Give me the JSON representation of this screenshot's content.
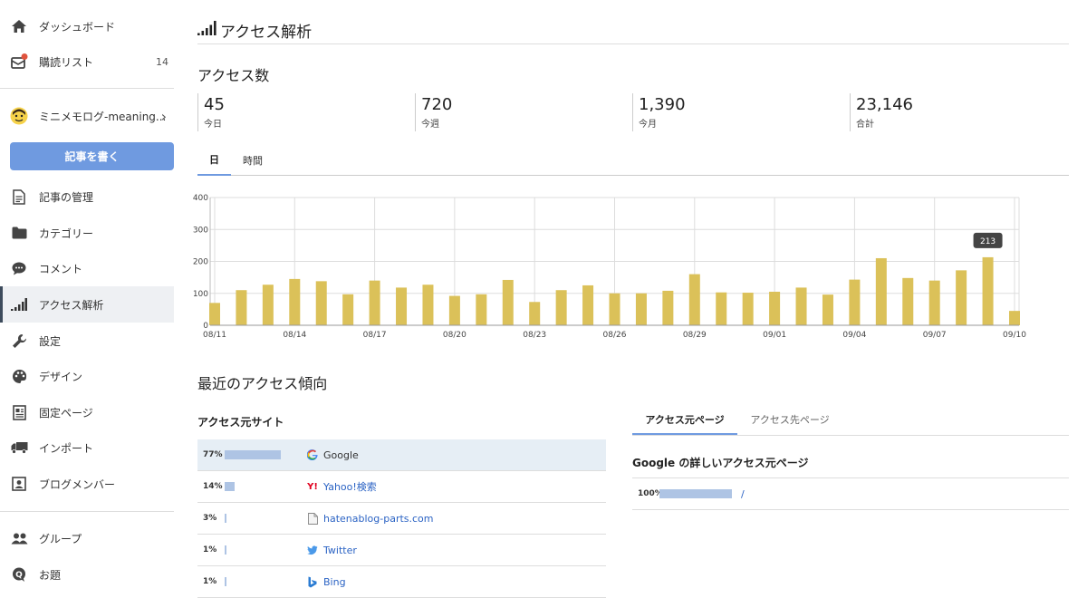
{
  "sidebar": {
    "dashboard": "ダッシュボード",
    "reading_list": "購読リスト",
    "reading_count": "14",
    "blog_name": "ミニメモログ-meaning...",
    "write_button": "記事を書く",
    "items": [
      {
        "label": "記事の管理",
        "icon": "document-icon"
      },
      {
        "label": "カテゴリー",
        "icon": "folder-icon"
      },
      {
        "label": "コメント",
        "icon": "comment-icon"
      },
      {
        "label": "アクセス解析",
        "icon": "signal-bars-icon"
      },
      {
        "label": "設定",
        "icon": "wrench-icon"
      },
      {
        "label": "デザイン",
        "icon": "palette-icon"
      },
      {
        "label": "固定ページ",
        "icon": "page-icon"
      },
      {
        "label": "インポート",
        "icon": "truck-icon"
      },
      {
        "label": "ブログメンバー",
        "icon": "member-card-icon"
      }
    ],
    "group": "グループ",
    "topic": "お題"
  },
  "header": {
    "title": "アクセス解析"
  },
  "access": {
    "title": "アクセス数",
    "stats": [
      {
        "value": "45",
        "label": "今日"
      },
      {
        "value": "720",
        "label": "今週"
      },
      {
        "value": "1,390",
        "label": "今月"
      },
      {
        "value": "23,146",
        "label": "合計"
      }
    ],
    "tabs": [
      "日",
      "時間"
    ]
  },
  "chart_data": {
    "type": "bar",
    "categories": [
      "08/11",
      "08/12",
      "08/13",
      "08/14",
      "08/15",
      "08/16",
      "08/17",
      "08/18",
      "08/19",
      "08/20",
      "08/21",
      "08/22",
      "08/23",
      "08/24",
      "08/25",
      "08/26",
      "08/27",
      "08/28",
      "08/29",
      "08/30",
      "08/31",
      "09/01",
      "09/02",
      "09/03",
      "09/04",
      "09/05",
      "09/06",
      "09/07",
      "09/08",
      "09/09",
      "09/10"
    ],
    "values": [
      70,
      110,
      127,
      145,
      138,
      97,
      140,
      118,
      127,
      92,
      97,
      142,
      73,
      110,
      125,
      100,
      100,
      108,
      160,
      103,
      102,
      105,
      118,
      96,
      143,
      210,
      148,
      140,
      172,
      213,
      45
    ],
    "tick_labels": [
      "08/11",
      "08/14",
      "08/17",
      "08/20",
      "08/23",
      "08/26",
      "08/29",
      "09/01",
      "09/04",
      "09/07",
      "09/10"
    ],
    "ylim": [
      0,
      400
    ],
    "yticks": [
      0,
      100,
      200,
      300,
      400
    ],
    "tooltip": "213",
    "color": "#dbc159",
    "grid": true
  },
  "trends": {
    "title": "最近のアクセス傾向",
    "sources_title": "アクセス元サイト",
    "sources": [
      {
        "percent": "77%",
        "fraction": 0.77,
        "name": "Google",
        "icon": "google-icon"
      },
      {
        "percent": "14%",
        "fraction": 0.14,
        "name": "Yahoo!検索",
        "icon": "yahoo-icon"
      },
      {
        "percent": "3%",
        "fraction": 0.03,
        "name": "hatenablog-parts.com",
        "icon": "file-icon"
      },
      {
        "percent": "1%",
        "fraction": 0.01,
        "name": "Twitter",
        "icon": "twitter-bird-icon"
      },
      {
        "percent": "1%",
        "fraction": 0.01,
        "name": "Bing",
        "icon": "bing-icon"
      }
    ],
    "right_tabs": [
      "アクセス元ページ",
      "アクセス先ページ"
    ],
    "detail_title": "Google の詳しいアクセス元ページ",
    "detail_rows": [
      {
        "percent": "100%",
        "fraction": 1.0,
        "path": "/"
      }
    ]
  },
  "colors": {
    "accent": "#6f9ae0",
    "bar": "#dbc159",
    "source_bar": "#aec4e4",
    "link": "#2b63c4"
  }
}
